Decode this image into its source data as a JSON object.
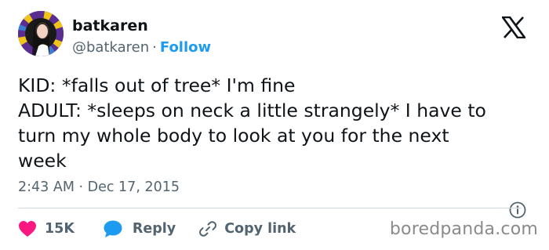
{
  "author": {
    "display_name": "batkaren",
    "handle": "@batkaren",
    "separator": "·",
    "follow_label": "Follow"
  },
  "brand_icon": "x-logo",
  "tweet": {
    "lines": [
      "KID: *falls out of tree* I'm fine",
      "ADULT: *sleeps on neck a little strangely* I have to",
      "turn my whole body to look at you for the next",
      "week"
    ],
    "timestamp": "2:43 AM · Dec 17, 2015"
  },
  "actions": {
    "like_count": "15K",
    "reply_label": "Reply",
    "copy_link_label": "Copy link"
  },
  "icons": [
    "heart-icon",
    "reply-bubble-icon",
    "link-icon",
    "info-icon"
  ],
  "colors": {
    "text": "#0f1419",
    "secondary": "#536471",
    "accent_blue": "#1d9bf0",
    "like_pink": "#f91880",
    "divider": "#cfd9de"
  },
  "watermark": "boredpanda.com"
}
